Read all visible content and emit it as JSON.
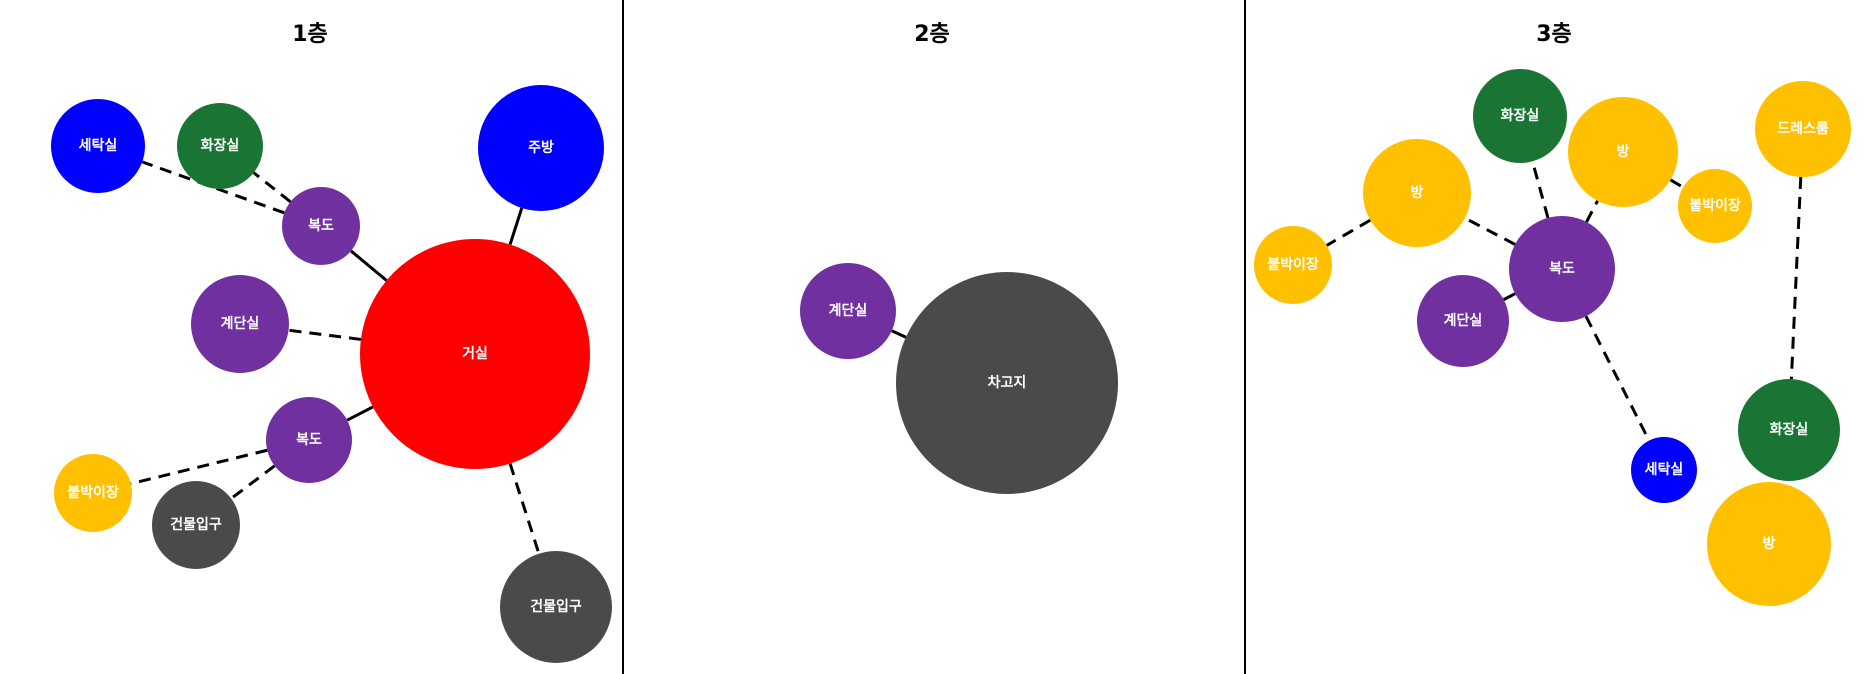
{
  "colors": {
    "red": "#ff0000",
    "blue": "#0000ff",
    "green": "#1a7434",
    "purple": "#7030a0",
    "yellow": "#ffc000",
    "gray": "#4a4a4a",
    "label": "#ffffff"
  },
  "panels": [
    {
      "title": "1층",
      "nodes": [
        {
          "id": "f1-living",
          "label": "거실",
          "color": "red"
        },
        {
          "id": "f1-kitchen",
          "label": "주방",
          "color": "blue"
        },
        {
          "id": "f1-laundry",
          "label": "세탁실",
          "color": "blue"
        },
        {
          "id": "f1-bathroom",
          "label": "화장실",
          "color": "green"
        },
        {
          "id": "f1-hall-a",
          "label": "복도",
          "color": "purple"
        },
        {
          "id": "f1-stairs",
          "label": "계단실",
          "color": "purple"
        },
        {
          "id": "f1-hall-b",
          "label": "복도",
          "color": "purple"
        },
        {
          "id": "f1-closet",
          "label": "붙박이장",
          "color": "yellow"
        },
        {
          "id": "f1-entrance-a",
          "label": "건물입구",
          "color": "gray"
        },
        {
          "id": "f1-entrance-b",
          "label": "건물입구",
          "color": "gray"
        }
      ],
      "edges": [
        {
          "from": "f1-living",
          "to": "f1-kitchen",
          "style": "solid"
        },
        {
          "from": "f1-living",
          "to": "f1-hall-a",
          "style": "solid"
        },
        {
          "from": "f1-living",
          "to": "f1-stairs",
          "style": "dashed"
        },
        {
          "from": "f1-living",
          "to": "f1-hall-b",
          "style": "solid"
        },
        {
          "from": "f1-living",
          "to": "f1-entrance-b",
          "style": "dashed"
        },
        {
          "from": "f1-hall-a",
          "to": "f1-laundry",
          "style": "dashed"
        },
        {
          "from": "f1-hall-a",
          "to": "f1-bathroom",
          "style": "dashed"
        },
        {
          "from": "f1-hall-b",
          "to": "f1-closet",
          "style": "dashed"
        },
        {
          "from": "f1-hall-b",
          "to": "f1-entrance-a",
          "style": "dashed"
        }
      ]
    },
    {
      "title": "2층",
      "nodes": [
        {
          "id": "f2-stairs",
          "label": "계단실",
          "color": "purple"
        },
        {
          "id": "f2-garage",
          "label": "차고지",
          "color": "gray"
        }
      ],
      "edges": [
        {
          "from": "f2-stairs",
          "to": "f2-garage",
          "style": "solid"
        }
      ]
    },
    {
      "title": "3층",
      "nodes": [
        {
          "id": "f3-hall",
          "label": "복도",
          "color": "purple"
        },
        {
          "id": "f3-bathroom-a",
          "label": "화장실",
          "color": "green"
        },
        {
          "id": "f3-room-a",
          "label": "방",
          "color": "yellow"
        },
        {
          "id": "f3-room-b",
          "label": "방",
          "color": "yellow"
        },
        {
          "id": "f3-closet-a",
          "label": "붙박이장",
          "color": "yellow"
        },
        {
          "id": "f3-closet-b",
          "label": "붙박이장",
          "color": "yellow"
        },
        {
          "id": "f3-stairs",
          "label": "계단실",
          "color": "purple"
        },
        {
          "id": "f3-laundry",
          "label": "세탁실",
          "color": "blue"
        },
        {
          "id": "f3-dressroom",
          "label": "드레스룸",
          "color": "yellow"
        },
        {
          "id": "f3-bathroom-b",
          "label": "화장실",
          "color": "green"
        },
        {
          "id": "f3-room-c",
          "label": "방",
          "color": "yellow"
        }
      ],
      "edges": [
        {
          "from": "f3-hall",
          "to": "f3-bathroom-a",
          "style": "dashed"
        },
        {
          "from": "f3-hall",
          "to": "f3-room-a",
          "style": "dashed"
        },
        {
          "from": "f3-hall",
          "to": "f3-room-b",
          "style": "dashed"
        },
        {
          "from": "f3-hall",
          "to": "f3-stairs",
          "style": "solid"
        },
        {
          "from": "f3-hall",
          "to": "f3-laundry",
          "style": "dashed"
        },
        {
          "from": "f3-room-a",
          "to": "f3-closet-a",
          "style": "dashed"
        },
        {
          "from": "f3-room-b",
          "to": "f3-closet-b",
          "style": "dashed"
        },
        {
          "from": "f3-dressroom",
          "to": "f3-bathroom-b",
          "style": "dashed"
        }
      ]
    }
  ]
}
